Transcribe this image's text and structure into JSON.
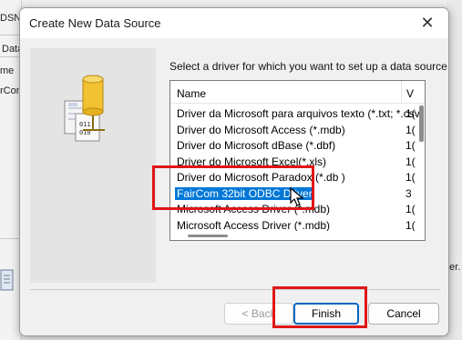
{
  "background": {
    "labels": [
      "DSN",
      "Data",
      "me",
      "rCom",
      "der."
    ]
  },
  "dialog": {
    "title": "Create New Data Source",
    "close_glyph": "✕",
    "instruction": "Select a driver for which you want to set up a data source.",
    "list": {
      "col_name": "Name",
      "col_version": "V",
      "rows": [
        {
          "name": "Driver da Microsoft para arquivos texto (*.txt; *.csv)",
          "version": "1("
        },
        {
          "name": "Driver do Microsoft Access (*.mdb)",
          "version": "1("
        },
        {
          "name": "Driver do Microsoft dBase (*.dbf)",
          "version": "1("
        },
        {
          "name": "Driver do Microsoft Excel(*.xls)",
          "version": "1("
        },
        {
          "name": "Driver do Microsoft Paradox (*.db )",
          "version": "1("
        },
        {
          "name": "FairCom 32bit ODBC Driver",
          "version": "3",
          "selected": true
        },
        {
          "name": "Microsoft Access Driver (*.mdb)",
          "version": "1("
        },
        {
          "name": "Microsoft Access Driver (*.mdb)",
          "version": "1("
        }
      ]
    },
    "buttons": {
      "back": "< Back",
      "finish": "Finish",
      "cancel": "Cancel"
    }
  },
  "colors": {
    "selection": "#0078d7",
    "highlight_box": "#e01616",
    "default_button_border": "#0067c0"
  },
  "icons": [
    "driver-database-icon",
    "close-icon",
    "mouse-cursor-icon"
  ]
}
